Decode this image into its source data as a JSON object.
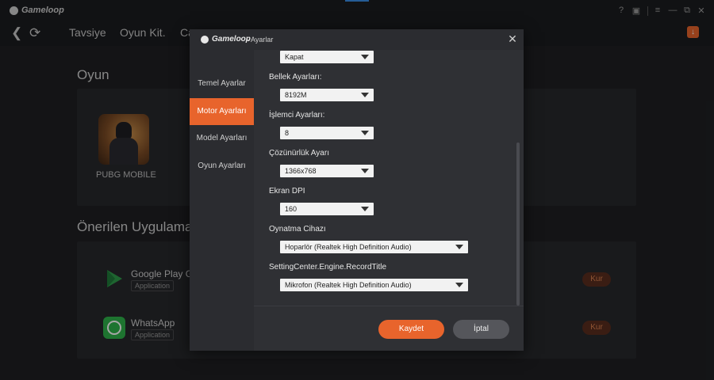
{
  "app": {
    "name": "Gameloop",
    "controls": [
      "?",
      "▣",
      "≡",
      "—",
      "⧉",
      "✕"
    ]
  },
  "nav": {
    "back_icon": "back-icon",
    "refresh_icon": "refresh-icon",
    "tabs": [
      "Tavsiye",
      "Oyun Kit.",
      "Ca"
    ]
  },
  "main": {
    "game_section_title": "Oyun",
    "game": {
      "name": "PUBG MOBILE"
    },
    "apps_section_title": "Önerilen Uygulamal",
    "apps": [
      {
        "name": "Google Play Ga",
        "tag": "Application",
        "action": "Kur"
      },
      {
        "name": "WhatsApp",
        "tag": "Application",
        "action": "Kur"
      }
    ]
  },
  "dialog": {
    "brand": "Gameloop",
    "title": " - Ayarlar",
    "close_icon": "close-icon",
    "sidebar": [
      {
        "label": "Temel Ayarlar",
        "active": false
      },
      {
        "label": "Motor Ayarları",
        "active": true
      },
      {
        "label": "Model Ayarları",
        "active": false
      },
      {
        "label": "Oyun Ayarları",
        "active": false
      }
    ],
    "fields": [
      {
        "label": "",
        "value": "Kapat"
      },
      {
        "label": "Bellek Ayarları:",
        "value": "8192M"
      },
      {
        "label": "İşlemci Ayarları:",
        "value": "8"
      },
      {
        "label": "Çözünürlük Ayarı",
        "value": "1366x768"
      },
      {
        "label": "Ekran DPI",
        "value": "160"
      },
      {
        "label": "Oynatma Cihazı",
        "value": "Hoparlör (Realtek High Definition Audio)"
      },
      {
        "label": "SettingCenter.Engine.RecordTitle",
        "value": "Mikrofon (Realtek High Definition Audio)"
      }
    ],
    "save_label": "Kaydet",
    "cancel_label": "İptal"
  },
  "colors": {
    "accent": "#e8642c",
    "background": "#1f2023",
    "dialog_bg": "#2f3034"
  }
}
